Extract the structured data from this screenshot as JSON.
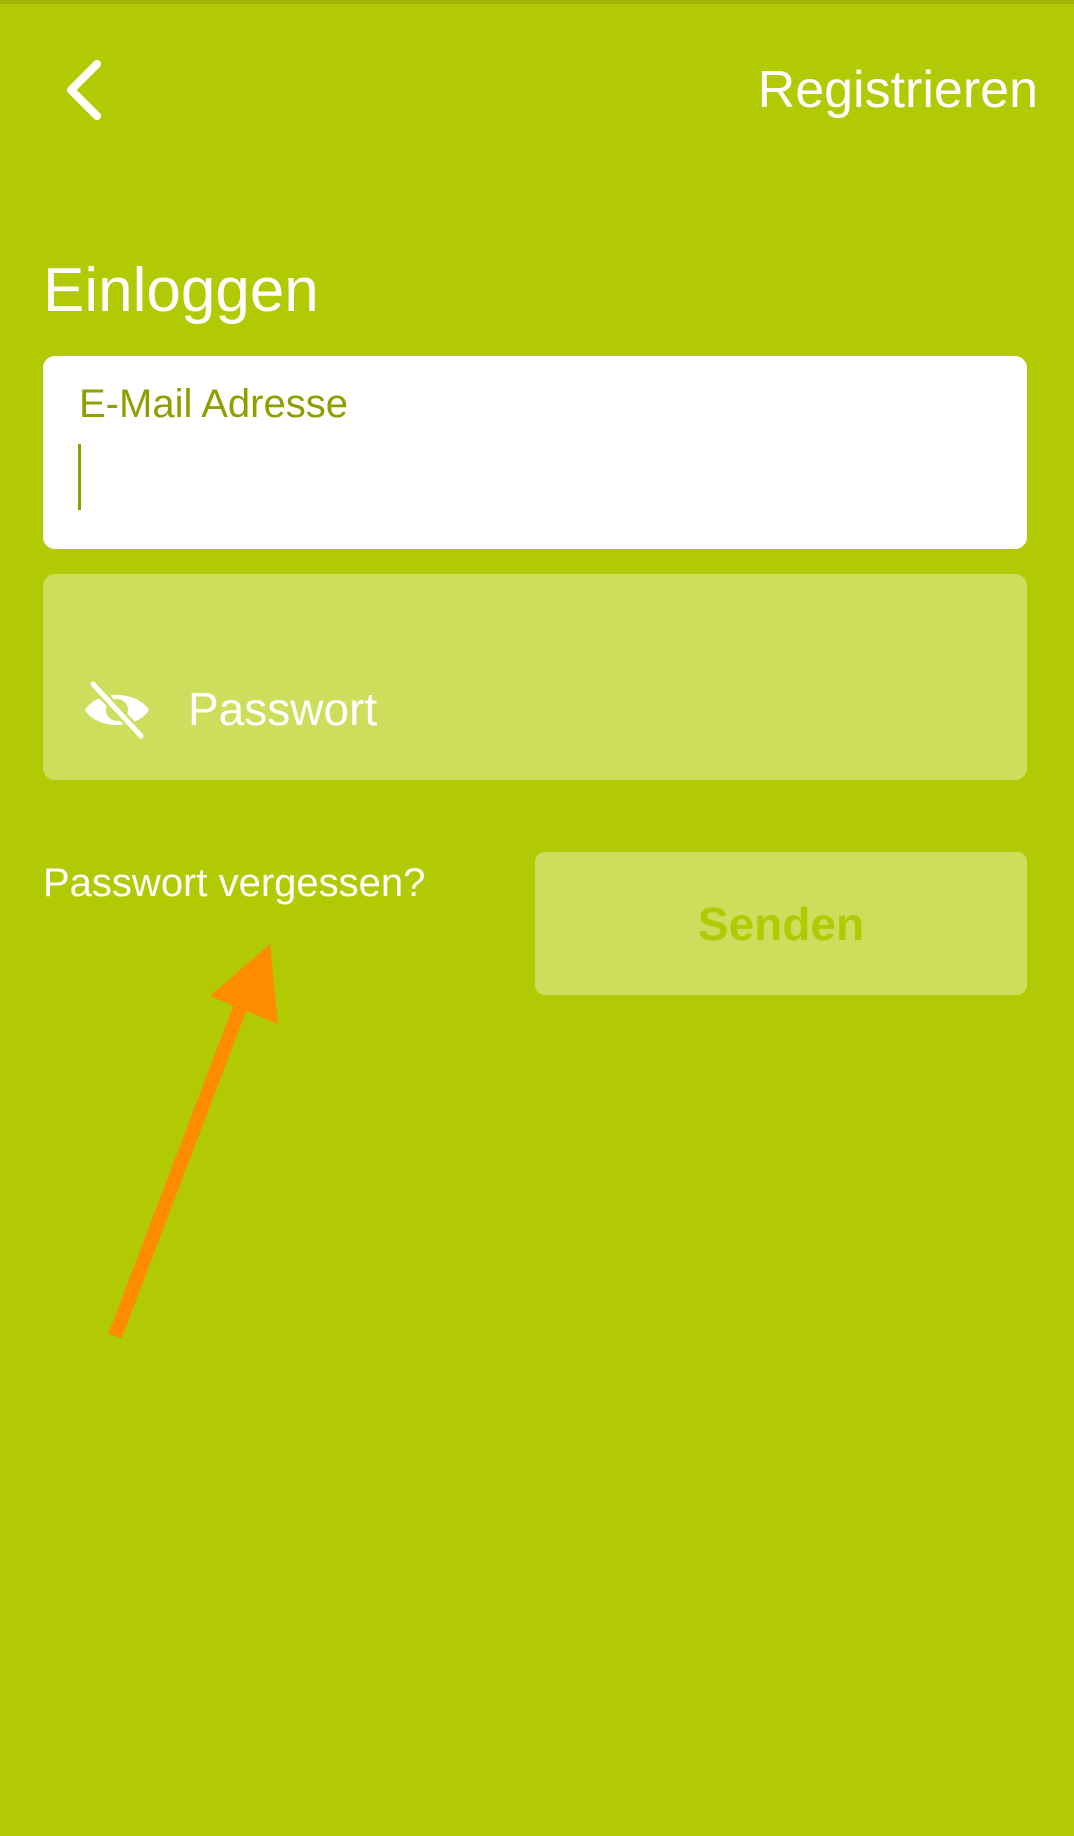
{
  "header": {
    "back_icon": "chevron-left-icon",
    "register_label": "Registrieren"
  },
  "form": {
    "title": "Einloggen",
    "email": {
      "label": "E-Mail Adresse",
      "value": ""
    },
    "password": {
      "placeholder": "Passwort",
      "visibility_icon": "eye-off-icon",
      "value": ""
    },
    "forgot_label": "Passwort vergessen?",
    "submit_label": "Senden"
  },
  "annotation": {
    "type": "arrow",
    "color": "#ff8c00",
    "points_to": "forgot-password-link"
  },
  "colors": {
    "background": "#b2ca04",
    "field_disabled": "#cdde5c",
    "accent_text": "#8da000"
  }
}
